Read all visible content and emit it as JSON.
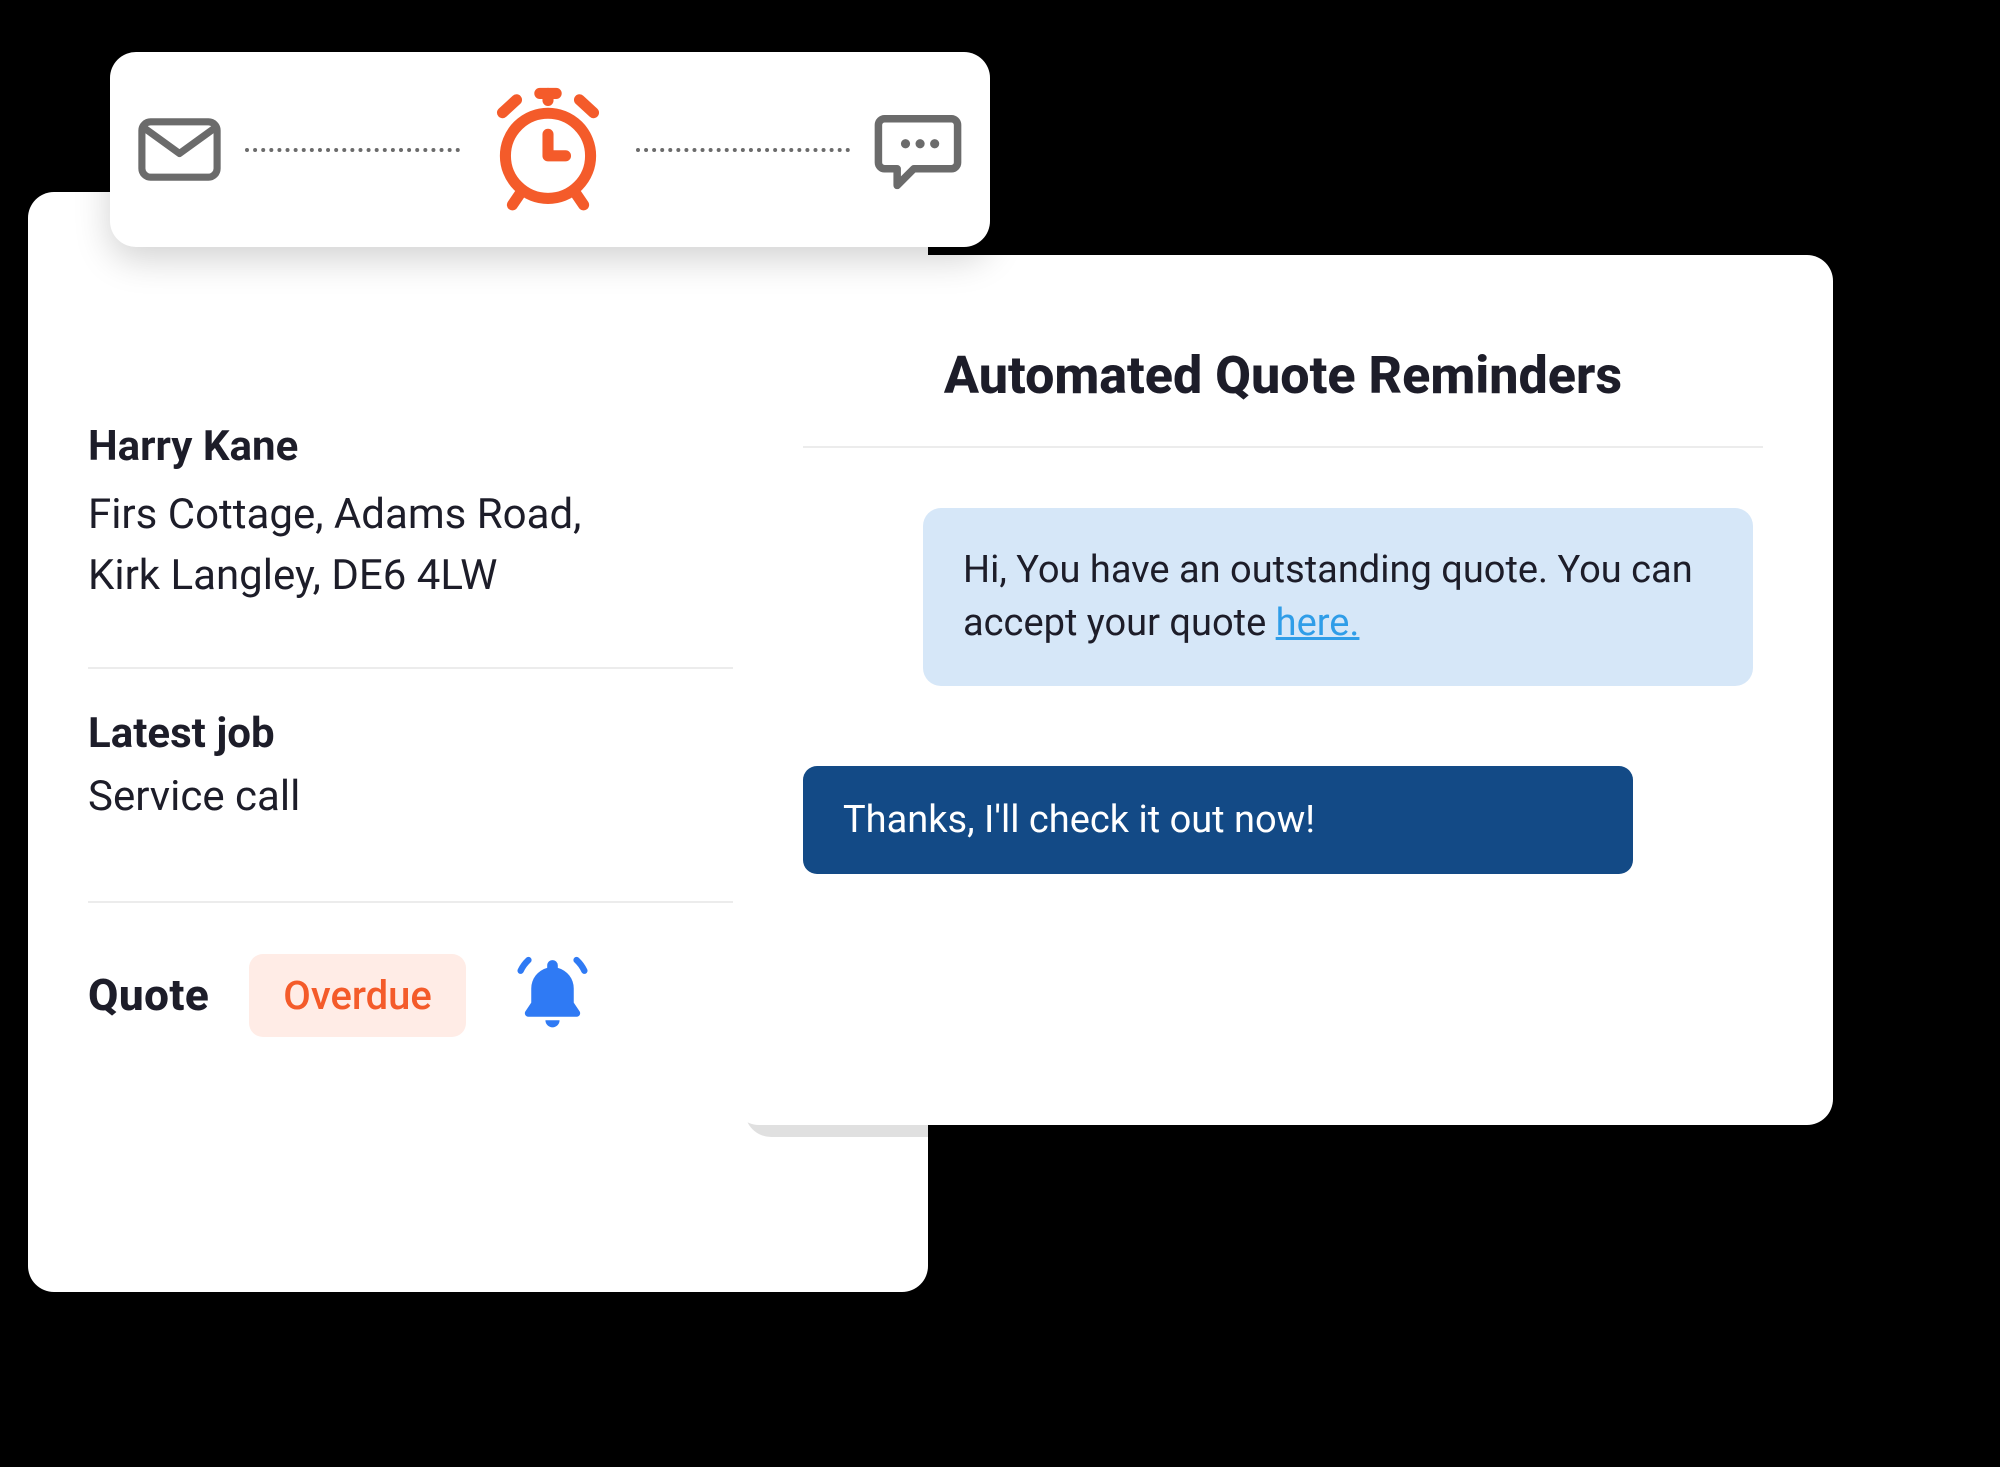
{
  "customer": {
    "name": "Harry Kane",
    "addr1": "Firs Cottage, Adams Road,",
    "addr2": "Kirk Langley, DE6 4LW",
    "latest_job_label": "Latest job",
    "latest_job_value": "Service call",
    "quote_label": "Quote",
    "quote_status": "Overdue"
  },
  "reminders": {
    "title": "Automated Quote Reminders",
    "system_msg_pre": "Hi, You have an outstanding quote. You can accept your quote ",
    "system_msg_link": "here.",
    "user_reply": "Thanks, I'll check it out now!"
  },
  "flow": {
    "step1_icon": "mail",
    "step2_icon": "alarm-clock",
    "step3_icon": "chat"
  }
}
